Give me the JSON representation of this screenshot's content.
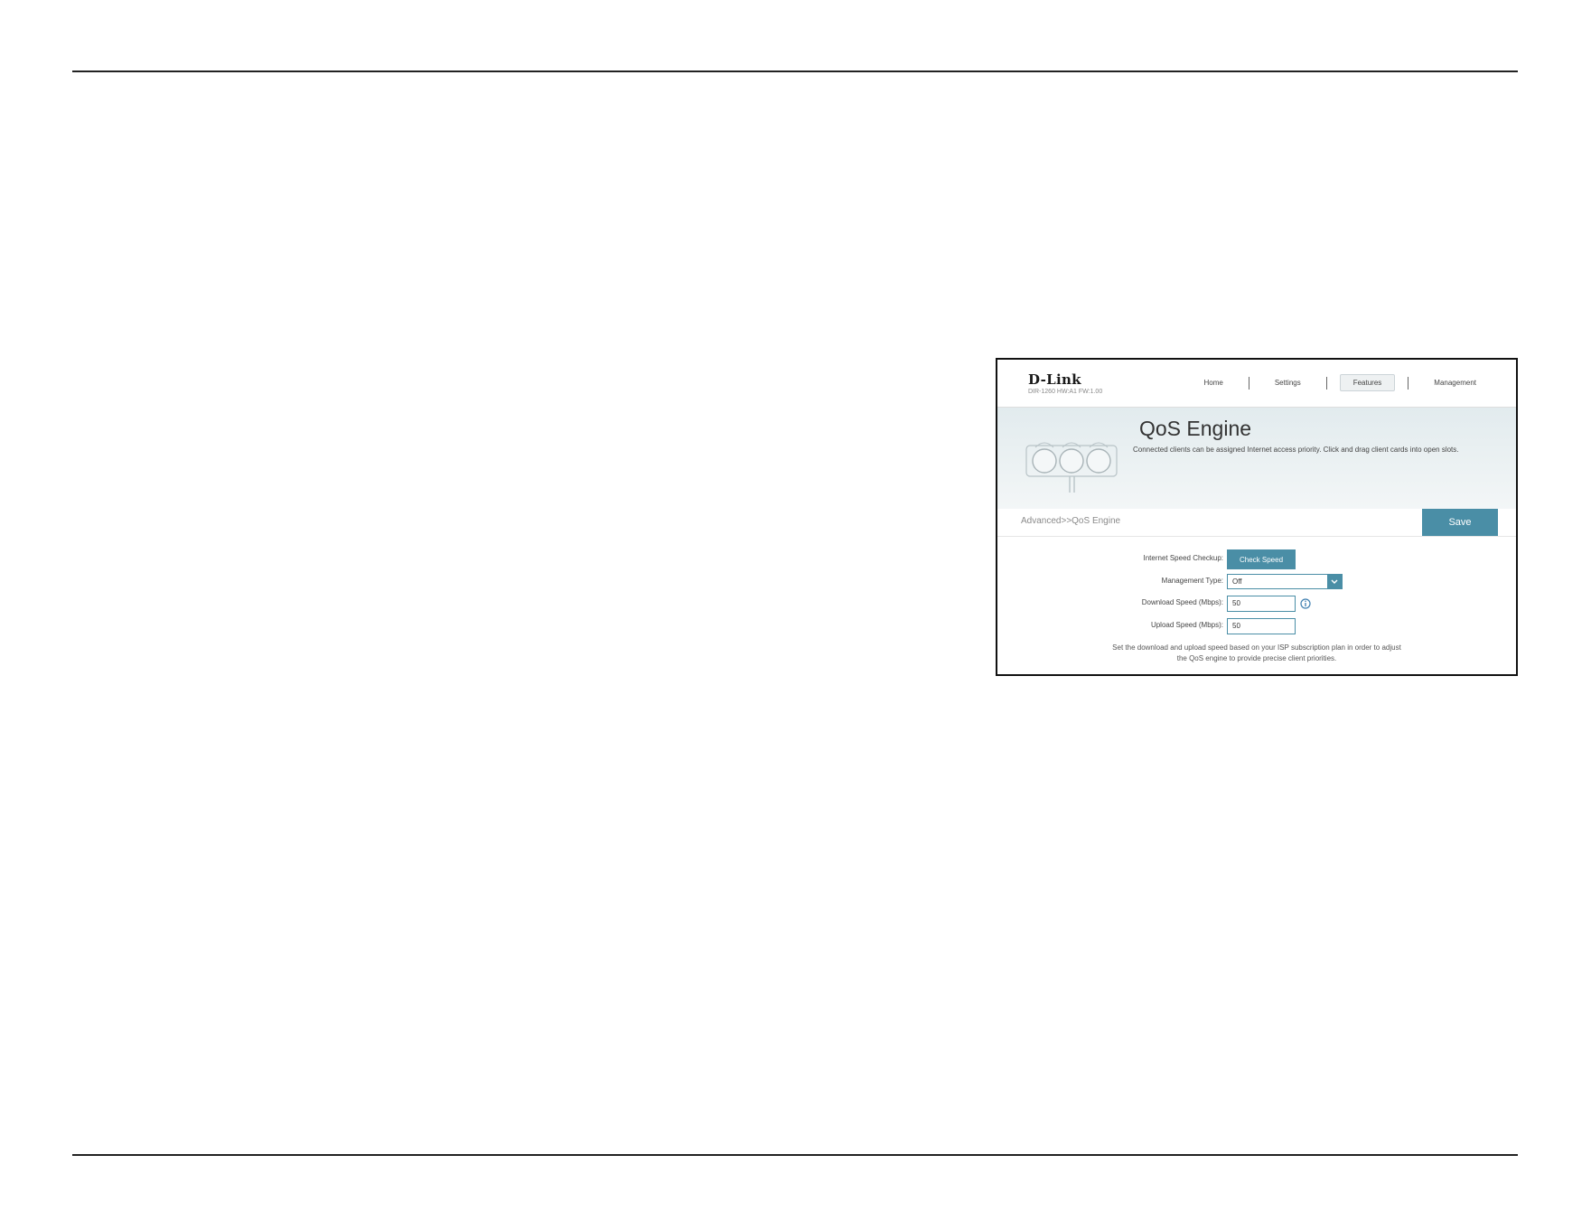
{
  "router_ui": {
    "brand": "D-Link",
    "firmware_info": "DIR-1260 HW:A1 FW:1.00",
    "nav": {
      "home": "Home",
      "settings": "Settings",
      "features": "Features",
      "management": "Management",
      "active": "Features"
    },
    "hero": {
      "title": "QoS Engine",
      "description": "Connected clients can be assigned Internet access priority. Click and drag client cards into open slots."
    },
    "breadcrumb": "Advanced>>QoS Engine",
    "save_label": "Save",
    "form": {
      "speed_checkup_label": "Internet Speed Checkup:",
      "check_speed_label": "Check Speed",
      "management_type_label": "Management Type:",
      "management_type_value": "Off",
      "download_label": "Download Speed (Mbps):",
      "download_value": "50",
      "upload_label": "Upload Speed (Mbps):",
      "upload_value": "50",
      "hint_line1": "Set the download and upload speed based on your ISP subscription plan in order to adjust",
      "hint_line2": "the QoS engine to provide precise client priorities."
    },
    "colors": {
      "accent": "#4a8ea6"
    },
    "icons": {
      "hero": "traffic-light-icon",
      "select_arrow": "chevron-down-icon",
      "info": "info-icon"
    }
  }
}
